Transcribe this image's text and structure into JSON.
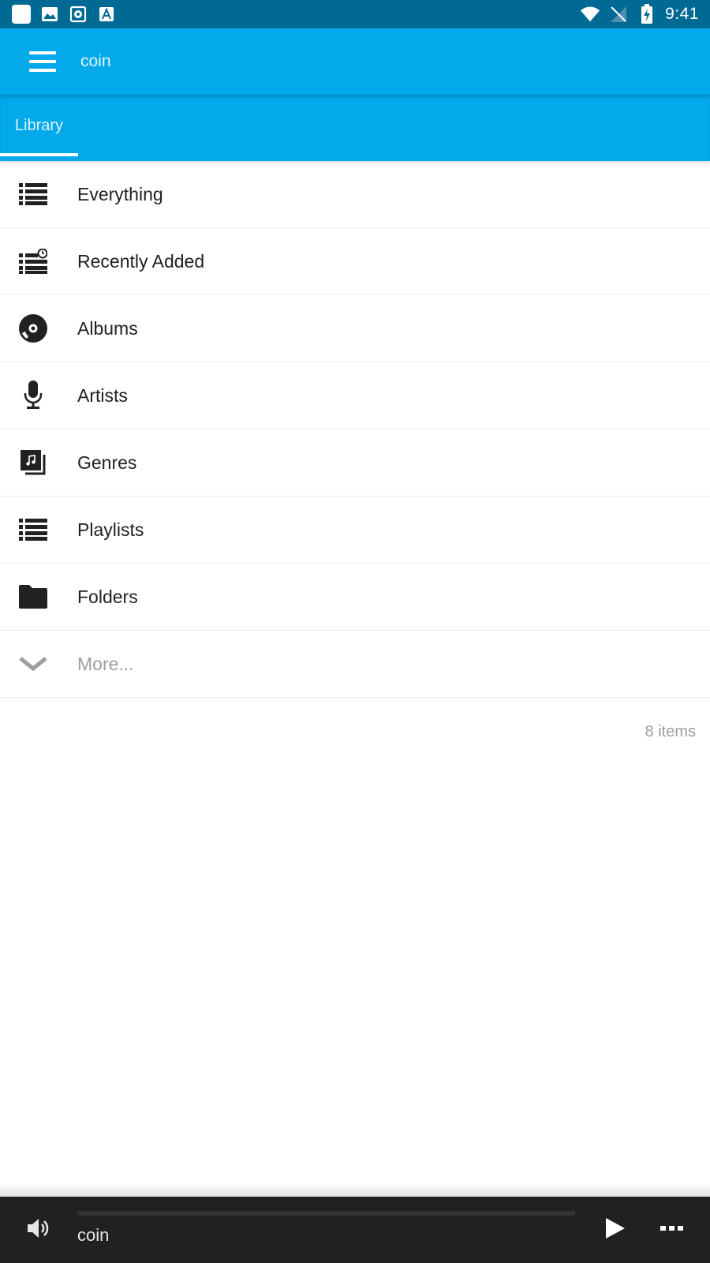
{
  "colors": {
    "status_bar": "#006994",
    "app_bar": "#03a9ea",
    "player_bg": "#212121",
    "muted_text": "#9e9e9e"
  },
  "status_bar": {
    "left_icons": [
      "app-notification-icon",
      "image-notification-icon",
      "photo-notification-icon",
      "text-notification-icon"
    ],
    "right_icons": [
      "wifi-icon",
      "no-signal-icon",
      "battery-charging-icon"
    ],
    "time": "9:41"
  },
  "app_bar": {
    "menu_icon": "hamburger-menu-icon",
    "title": "coin"
  },
  "tabs": [
    {
      "label": "Library",
      "selected": true
    }
  ],
  "library": {
    "items": [
      {
        "label": "Everything",
        "icon": "list-icon"
      },
      {
        "label": "Recently Added",
        "icon": "recent-list-icon"
      },
      {
        "label": "Albums",
        "icon": "disc-icon"
      },
      {
        "label": "Artists",
        "icon": "microphone-icon"
      },
      {
        "label": "Genres",
        "icon": "music-note-stack-icon"
      },
      {
        "label": "Playlists",
        "icon": "playlist-icon"
      },
      {
        "label": "Folders",
        "icon": "folder-icon"
      },
      {
        "label": "More...",
        "icon": "chevron-down-icon"
      }
    ],
    "count_text": "8 items"
  },
  "player": {
    "track": "coin",
    "progress": 0,
    "volume_icon": "volume-icon",
    "play_icon": "play-icon",
    "overflow_icon": "more-horizontal-icon"
  }
}
